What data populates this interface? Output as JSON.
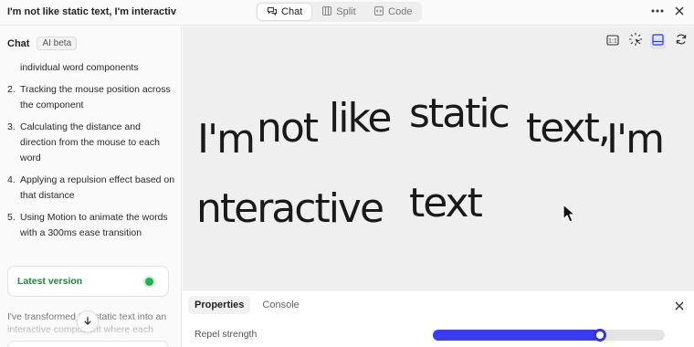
{
  "header": {
    "title": "I'm not like static text, I'm interactive ...",
    "tabs": [
      {
        "label": "Chat",
        "icon": "chat-bubbles-icon",
        "active": true
      },
      {
        "label": "Split",
        "icon": "split-columns-icon",
        "active": false
      },
      {
        "label": "Code",
        "icon": "code-brackets-icon",
        "active": false
      }
    ],
    "menu_icon": "more-horizontal-icon",
    "close_icon": "close-icon"
  },
  "sidebar": {
    "title": "Chat",
    "badge": "AI beta",
    "intro_fragment": "individual word components",
    "steps": [
      {
        "num": "2.",
        "text": "Tracking the mouse position across the component"
      },
      {
        "num": "3.",
        "text": "Calculating the distance and direction from the mouse to each word"
      },
      {
        "num": "4.",
        "text": "Applying a repulsion effect based on that distance"
      },
      {
        "num": "5.",
        "text": "Using Motion to animate the words with a 300ms ease transition"
      }
    ],
    "version_label": "Latest version",
    "trailing_text": "I've transformed the static text into an interactive component where each"
  },
  "preview": {
    "tools": [
      {
        "icon": "aspect-ratio-icon",
        "active": false
      },
      {
        "icon": "cursor-sparkle-icon",
        "active": false
      },
      {
        "icon": "panel-bottom-icon",
        "active": true
      },
      {
        "icon": "refresh-icon",
        "active": false
      }
    ],
    "words": [
      {
        "text": "I'm"
      },
      {
        "text": "not"
      },
      {
        "text": "like"
      },
      {
        "text": "static"
      },
      {
        "text": "text,"
      },
      {
        "text": "I'm"
      },
      {
        "text": "nteractive"
      },
      {
        "text": "text"
      }
    ]
  },
  "properties": {
    "tabs": [
      {
        "label": "Properties",
        "active": true
      },
      {
        "label": "Console",
        "active": false
      }
    ],
    "repel_label": "Repel strength",
    "repel_fraction": 0.72,
    "accent_color": "#3b3bf0"
  }
}
